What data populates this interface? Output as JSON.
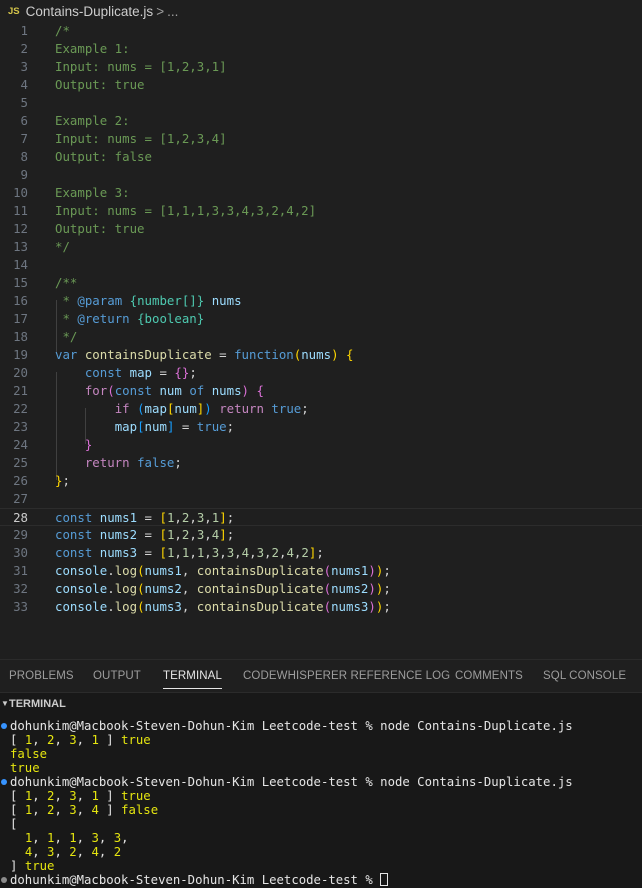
{
  "breadcrumb": {
    "file_icon": "JS",
    "file": "Contains-Duplicate.js",
    "separator": ">",
    "ellipsis": "..."
  },
  "editor": {
    "current_line": 28,
    "lines": [
      {
        "n": "1",
        "tokens": [
          [
            "c-com",
            "/*"
          ]
        ]
      },
      {
        "n": "2",
        "tokens": [
          [
            "c-com",
            "Example 1:"
          ]
        ]
      },
      {
        "n": "3",
        "tokens": [
          [
            "c-com",
            "Input: nums = [1,2,3,1]"
          ]
        ]
      },
      {
        "n": "4",
        "tokens": [
          [
            "c-com",
            "Output: true"
          ]
        ]
      },
      {
        "n": "5",
        "tokens": []
      },
      {
        "n": "6",
        "tokens": [
          [
            "c-com",
            "Example 2:"
          ]
        ]
      },
      {
        "n": "7",
        "tokens": [
          [
            "c-com",
            "Input: nums = [1,2,3,4]"
          ]
        ]
      },
      {
        "n": "8",
        "tokens": [
          [
            "c-com",
            "Output: false"
          ]
        ]
      },
      {
        "n": "9",
        "tokens": []
      },
      {
        "n": "10",
        "tokens": [
          [
            "c-com",
            "Example 3:"
          ]
        ]
      },
      {
        "n": "11",
        "tokens": [
          [
            "c-com",
            "Input: nums = [1,1,1,3,3,4,3,2,4,2]"
          ]
        ]
      },
      {
        "n": "12",
        "tokens": [
          [
            "c-com",
            "Output: true"
          ]
        ]
      },
      {
        "n": "13",
        "tokens": [
          [
            "c-com",
            "*/"
          ]
        ]
      },
      {
        "n": "14",
        "tokens": []
      },
      {
        "n": "15",
        "tokens": [
          [
            "c-com",
            "/**"
          ]
        ]
      },
      {
        "n": "16",
        "tokens": [
          [
            "c-com",
            " * "
          ],
          [
            "c-kw",
            "@param"
          ],
          [
            "c-com",
            " "
          ],
          [
            "c-type",
            "{number[]}"
          ],
          [
            "c-com",
            " "
          ],
          [
            "c-var",
            "nums"
          ]
        ]
      },
      {
        "n": "17",
        "tokens": [
          [
            "c-com",
            " * "
          ],
          [
            "c-kw",
            "@return"
          ],
          [
            "c-com",
            " "
          ],
          [
            "c-type",
            "{boolean}"
          ]
        ]
      },
      {
        "n": "18",
        "tokens": [
          [
            "c-com",
            " */"
          ]
        ]
      },
      {
        "n": "19",
        "tokens": [
          [
            "c-kw",
            "var "
          ],
          [
            "c-fn",
            "containsDuplicate"
          ],
          [
            "c-txt",
            " = "
          ],
          [
            "c-kw",
            "function"
          ],
          [
            "c-br1",
            "("
          ],
          [
            "c-var",
            "nums"
          ],
          [
            "c-br1",
            ")"
          ],
          [
            "c-txt",
            " "
          ],
          [
            "c-br1",
            "{"
          ]
        ]
      },
      {
        "n": "20",
        "tokens": [
          [
            "c-txt",
            "    "
          ],
          [
            "c-kw",
            "const "
          ],
          [
            "c-var",
            "map"
          ],
          [
            "c-txt",
            " = "
          ],
          [
            "c-br2",
            "{}"
          ],
          [
            "c-txt",
            ";"
          ]
        ]
      },
      {
        "n": "21",
        "tokens": [
          [
            "c-txt",
            "    "
          ],
          [
            "c-ctl",
            "for"
          ],
          [
            "c-br2",
            "("
          ],
          [
            "c-kw",
            "const "
          ],
          [
            "c-var",
            "num"
          ],
          [
            "c-kw",
            " of "
          ],
          [
            "c-var",
            "nums"
          ],
          [
            "c-br2",
            ")"
          ],
          [
            "c-txt",
            " "
          ],
          [
            "c-br2",
            "{"
          ]
        ]
      },
      {
        "n": "22",
        "tokens": [
          [
            "c-txt",
            "        "
          ],
          [
            "c-ctl",
            "if "
          ],
          [
            "c-br3",
            "("
          ],
          [
            "c-var",
            "map"
          ],
          [
            "c-br1",
            "["
          ],
          [
            "c-var",
            "num"
          ],
          [
            "c-br1",
            "]"
          ],
          [
            "c-br3",
            ")"
          ],
          [
            "c-txt",
            " "
          ],
          [
            "c-ctl",
            "return "
          ],
          [
            "c-kw",
            "true"
          ],
          [
            "c-txt",
            ";"
          ]
        ]
      },
      {
        "n": "23",
        "tokens": [
          [
            "c-txt",
            "        "
          ],
          [
            "c-var",
            "map"
          ],
          [
            "c-br3",
            "["
          ],
          [
            "c-var",
            "num"
          ],
          [
            "c-br3",
            "]"
          ],
          [
            "c-txt",
            " = "
          ],
          [
            "c-kw",
            "true"
          ],
          [
            "c-txt",
            ";"
          ]
        ]
      },
      {
        "n": "24",
        "tokens": [
          [
            "c-txt",
            "    "
          ],
          [
            "c-br2",
            "}"
          ]
        ]
      },
      {
        "n": "25",
        "tokens": [
          [
            "c-txt",
            "    "
          ],
          [
            "c-ctl",
            "return "
          ],
          [
            "c-kw",
            "false"
          ],
          [
            "c-txt",
            ";"
          ]
        ]
      },
      {
        "n": "26",
        "tokens": [
          [
            "c-br1",
            "}"
          ],
          [
            "c-txt",
            ";"
          ]
        ]
      },
      {
        "n": "27",
        "tokens": []
      },
      {
        "n": "28",
        "tokens": [
          [
            "c-kw",
            "const "
          ],
          [
            "c-var",
            "nums1"
          ],
          [
            "c-txt",
            " = "
          ],
          [
            "c-br1",
            "["
          ],
          [
            "c-num",
            "1"
          ],
          [
            "c-txt",
            ","
          ],
          [
            "c-num",
            "2"
          ],
          [
            "c-txt",
            ","
          ],
          [
            "c-num",
            "3"
          ],
          [
            "c-txt",
            ","
          ],
          [
            "c-num",
            "1"
          ],
          [
            "c-br1",
            "]"
          ],
          [
            "c-txt",
            ";"
          ]
        ]
      },
      {
        "n": "29",
        "tokens": [
          [
            "c-kw",
            "const "
          ],
          [
            "c-var",
            "nums2"
          ],
          [
            "c-txt",
            " = "
          ],
          [
            "c-br1",
            "["
          ],
          [
            "c-num",
            "1"
          ],
          [
            "c-txt",
            ","
          ],
          [
            "c-num",
            "2"
          ],
          [
            "c-txt",
            ","
          ],
          [
            "c-num",
            "3"
          ],
          [
            "c-txt",
            ","
          ],
          [
            "c-num",
            "4"
          ],
          [
            "c-br1",
            "]"
          ],
          [
            "c-txt",
            ";"
          ]
        ]
      },
      {
        "n": "30",
        "tokens": [
          [
            "c-kw",
            "const "
          ],
          [
            "c-var",
            "nums3"
          ],
          [
            "c-txt",
            " = "
          ],
          [
            "c-br1",
            "["
          ],
          [
            "c-num",
            "1"
          ],
          [
            "c-txt",
            ","
          ],
          [
            "c-num",
            "1"
          ],
          [
            "c-txt",
            ","
          ],
          [
            "c-num",
            "1"
          ],
          [
            "c-txt",
            ","
          ],
          [
            "c-num",
            "3"
          ],
          [
            "c-txt",
            ","
          ],
          [
            "c-num",
            "3"
          ],
          [
            "c-txt",
            ","
          ],
          [
            "c-num",
            "4"
          ],
          [
            "c-txt",
            ","
          ],
          [
            "c-num",
            "3"
          ],
          [
            "c-txt",
            ","
          ],
          [
            "c-num",
            "2"
          ],
          [
            "c-txt",
            ","
          ],
          [
            "c-num",
            "4"
          ],
          [
            "c-txt",
            ","
          ],
          [
            "c-num",
            "2"
          ],
          [
            "c-br1",
            "]"
          ],
          [
            "c-txt",
            ";"
          ]
        ]
      },
      {
        "n": "31",
        "tokens": [
          [
            "c-var",
            "console"
          ],
          [
            "c-txt",
            "."
          ],
          [
            "c-fn",
            "log"
          ],
          [
            "c-br1",
            "("
          ],
          [
            "c-var",
            "nums1"
          ],
          [
            "c-txt",
            ", "
          ],
          [
            "c-fn",
            "containsDuplicate"
          ],
          [
            "c-br2",
            "("
          ],
          [
            "c-var",
            "nums1"
          ],
          [
            "c-br2",
            ")"
          ],
          [
            "c-br1",
            ")"
          ],
          [
            "c-txt",
            ";"
          ]
        ]
      },
      {
        "n": "32",
        "tokens": [
          [
            "c-var",
            "console"
          ],
          [
            "c-txt",
            "."
          ],
          [
            "c-fn",
            "log"
          ],
          [
            "c-br1",
            "("
          ],
          [
            "c-var",
            "nums2"
          ],
          [
            "c-txt",
            ", "
          ],
          [
            "c-fn",
            "containsDuplicate"
          ],
          [
            "c-br2",
            "("
          ],
          [
            "c-var",
            "nums2"
          ],
          [
            "c-br2",
            ")"
          ],
          [
            "c-br1",
            ")"
          ],
          [
            "c-txt",
            ";"
          ]
        ]
      },
      {
        "n": "33",
        "tokens": [
          [
            "c-var",
            "console"
          ],
          [
            "c-txt",
            "."
          ],
          [
            "c-fn",
            "log"
          ],
          [
            "c-br1",
            "("
          ],
          [
            "c-var",
            "nums3"
          ],
          [
            "c-txt",
            ", "
          ],
          [
            "c-fn",
            "containsDuplicate"
          ],
          [
            "c-br2",
            "("
          ],
          [
            "c-var",
            "nums3"
          ],
          [
            "c-br2",
            ")"
          ],
          [
            "c-br1",
            ")"
          ],
          [
            "c-txt",
            ";"
          ]
        ]
      }
    ]
  },
  "panel": {
    "tabs": [
      {
        "label": "PROBLEMS",
        "active": false
      },
      {
        "label": "OUTPUT",
        "active": false
      },
      {
        "label": "TERMINAL",
        "active": true
      },
      {
        "label": "CODEWHISPERER REFERENCE LOG",
        "active": false
      },
      {
        "label": "COMMENTS",
        "active": false
      },
      {
        "label": "SQL CONSOLE",
        "active": false
      }
    ],
    "terminal_header": "TERMINAL",
    "chevron_icon": "chevron-down-icon"
  },
  "terminal": {
    "lines": [
      {
        "dot": "blue",
        "tokens": [
          [
            "t-white",
            "dohunkim@Macbook-Steven-Dohun-Kim Leetcode-test % node Contains-Duplicate.js"
          ]
        ]
      },
      {
        "dot": null,
        "tokens": [
          [
            "t-white",
            "[ "
          ],
          [
            "t-num",
            "1"
          ],
          [
            "t-white",
            ", "
          ],
          [
            "t-num",
            "2"
          ],
          [
            "t-white",
            ", "
          ],
          [
            "t-num",
            "3"
          ],
          [
            "t-white",
            ", "
          ],
          [
            "t-num",
            "1"
          ],
          [
            "t-white",
            " ] "
          ],
          [
            "t-yellow",
            "true"
          ]
        ]
      },
      {
        "dot": null,
        "tokens": [
          [
            "t-yellow",
            "false"
          ]
        ]
      },
      {
        "dot": null,
        "tokens": [
          [
            "t-yellow",
            "true"
          ]
        ]
      },
      {
        "dot": "blue",
        "tokens": [
          [
            "t-white",
            "dohunkim@Macbook-Steven-Dohun-Kim Leetcode-test % node Contains-Duplicate.js"
          ]
        ]
      },
      {
        "dot": null,
        "tokens": [
          [
            "t-white",
            "[ "
          ],
          [
            "t-num",
            "1"
          ],
          [
            "t-white",
            ", "
          ],
          [
            "t-num",
            "2"
          ],
          [
            "t-white",
            ", "
          ],
          [
            "t-num",
            "3"
          ],
          [
            "t-white",
            ", "
          ],
          [
            "t-num",
            "1"
          ],
          [
            "t-white",
            " ] "
          ],
          [
            "t-yellow",
            "true"
          ]
        ]
      },
      {
        "dot": null,
        "tokens": [
          [
            "t-white",
            "[ "
          ],
          [
            "t-num",
            "1"
          ],
          [
            "t-white",
            ", "
          ],
          [
            "t-num",
            "2"
          ],
          [
            "t-white",
            ", "
          ],
          [
            "t-num",
            "3"
          ],
          [
            "t-white",
            ", "
          ],
          [
            "t-num",
            "4"
          ],
          [
            "t-white",
            " ] "
          ],
          [
            "t-yellow",
            "false"
          ]
        ]
      },
      {
        "dot": null,
        "tokens": [
          [
            "t-white",
            "["
          ]
        ]
      },
      {
        "dot": null,
        "tokens": [
          [
            "t-white",
            "  "
          ],
          [
            "t-num",
            "1"
          ],
          [
            "t-white",
            ", "
          ],
          [
            "t-num",
            "1"
          ],
          [
            "t-white",
            ", "
          ],
          [
            "t-num",
            "1"
          ],
          [
            "t-white",
            ", "
          ],
          [
            "t-num",
            "3"
          ],
          [
            "t-white",
            ", "
          ],
          [
            "t-num",
            "3"
          ],
          [
            "t-white",
            ","
          ]
        ]
      },
      {
        "dot": null,
        "tokens": [
          [
            "t-white",
            "  "
          ],
          [
            "t-num",
            "4"
          ],
          [
            "t-white",
            ", "
          ],
          [
            "t-num",
            "3"
          ],
          [
            "t-white",
            ", "
          ],
          [
            "t-num",
            "2"
          ],
          [
            "t-white",
            ", "
          ],
          [
            "t-num",
            "4"
          ],
          [
            "t-white",
            ", "
          ],
          [
            "t-num",
            "2"
          ]
        ]
      },
      {
        "dot": null,
        "tokens": [
          [
            "t-white",
            "] "
          ],
          [
            "t-yellow",
            "true"
          ]
        ]
      },
      {
        "dot": "gray",
        "tokens": [
          [
            "t-white",
            "dohunkim@Macbook-Steven-Dohun-Kim Leetcode-test % "
          ]
        ],
        "cursor": true
      }
    ]
  },
  "colors": {
    "background": "#1f1f1f",
    "terminal_background": "#181818",
    "comment": "#6a9955",
    "keyword": "#569cd6",
    "function": "#dcdcaa",
    "variable": "#9cdcfe",
    "number": "#b5cea8",
    "terminal_yellow": "#e5e510",
    "prompt_dot": "#3794ff"
  }
}
